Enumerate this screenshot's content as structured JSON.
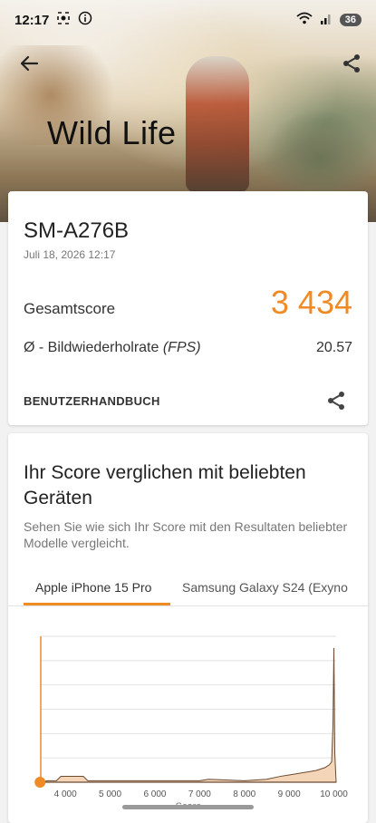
{
  "status_bar": {
    "time": "12:17",
    "battery": "36"
  },
  "hero": {
    "title": "Wild Life"
  },
  "result": {
    "device": "SM-A276B",
    "datetime": "Juli 18, 2026 12:17",
    "score_label": "Gesamtscore",
    "score_value": "3 434",
    "fps_label_prefix": "Ø - Bildwiederholrate ",
    "fps_label_unit": "(FPS)",
    "fps_value": "20.57",
    "manual_link": "BENUTZERHANDBUCH"
  },
  "compare": {
    "title": "Ihr Score verglichen mit beliebten Geräten",
    "subtitle": "Sehen Sie wie sich Ihr Score mit den Resultaten beliebter Modelle vergleicht.",
    "tabs": [
      {
        "label": "Apple iPhone 15 Pro",
        "active": true
      },
      {
        "label": "Samsung Galaxy S24 (Exyno",
        "active": false
      }
    ]
  },
  "colors": {
    "accent": "#f08a24",
    "area_fill": "#f5d5b8",
    "marker": "#f08a24"
  },
  "icons": {
    "back": "arrow-left-icon",
    "share": "share-icon"
  },
  "chart_data": {
    "type": "area",
    "xlabel": "Score",
    "ylabel": "",
    "x_ticks": [
      "4 000",
      "5 000",
      "6 000",
      "7 000",
      "8 000",
      "9 000",
      "10 000"
    ],
    "x_tick_values": [
      4000,
      5000,
      6000,
      7000,
      8000,
      9000,
      10000
    ],
    "xlim": [
      3450,
      10050
    ],
    "ylim": [
      0,
      100
    ],
    "grid": true,
    "your_score": 3434,
    "series": [
      {
        "x": [
          3450,
          3600,
          3800,
          3900,
          4400,
          4500,
          5000,
          6000,
          7000,
          7200,
          8000,
          8500,
          8800,
          9000,
          9200,
          9400,
          9600,
          9700,
          9800,
          9850,
          9900,
          9950,
          9980,
          10000,
          10020,
          10050
        ],
        "y": [
          0,
          1,
          1,
          4,
          4,
          1,
          1,
          1,
          1,
          2,
          1,
          2,
          4,
          5,
          6,
          7,
          8,
          9,
          10,
          11,
          12,
          14,
          40,
          92,
          20,
          0
        ]
      }
    ]
  }
}
